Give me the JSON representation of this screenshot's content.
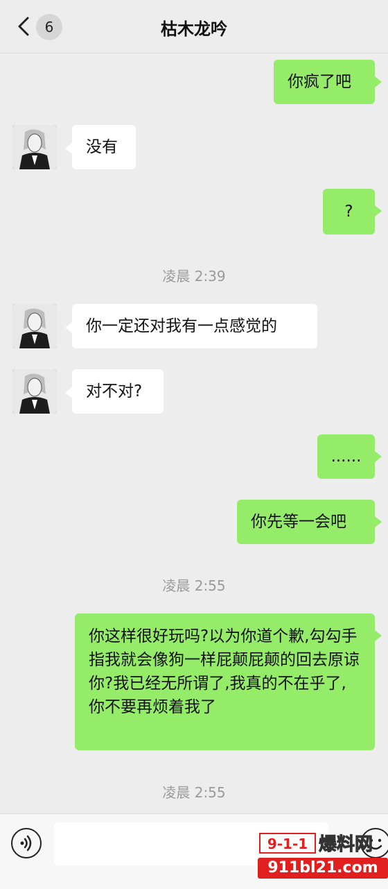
{
  "header": {
    "title": "枯木龙吟",
    "badge_count": "6"
  },
  "messages": [
    {
      "side": "out",
      "text": "你疯了吧"
    },
    {
      "side": "in",
      "text": "没有"
    },
    {
      "side": "out",
      "text": "?"
    },
    {
      "time": "凌晨 2:39"
    },
    {
      "side": "in",
      "text": "你一定还对我有一点感觉的"
    },
    {
      "side": "in",
      "text": "对不对?"
    },
    {
      "side": "out",
      "text": "......"
    },
    {
      "side": "out",
      "text": "你先等一会吧"
    },
    {
      "time": "凌晨 2:55"
    },
    {
      "side": "out",
      "text": "你这样很好玩吗?以为你道个歉,勾勾手指我就会像狗一样屁颠屁颠的回去原谅你?我已经无所谓了,我真的不在乎了,你不要再烦着我了"
    },
    {
      "time": "凌晨 2:55"
    }
  ],
  "input": {
    "value": ""
  },
  "watermark": {
    "digits": "9-1-1",
    "cn": "爆料网",
    "url": "911bl21.com"
  },
  "colors": {
    "outgoing_bubble": "#95ec69",
    "incoming_bubble": "#ffffff",
    "background": "#ededed"
  }
}
